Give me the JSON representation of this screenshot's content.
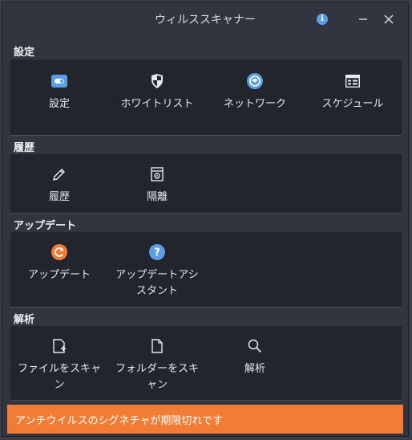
{
  "window": {
    "title": "ウィルススキャナー"
  },
  "sections": {
    "settings": {
      "title": "設定",
      "items": [
        {
          "label": "設定",
          "icon": "toggle-icon"
        },
        {
          "label": "ホワイトリスト",
          "icon": "shield-icon"
        },
        {
          "label": "ネットワーク",
          "icon": "globe-icon"
        },
        {
          "label": "スケジュール",
          "icon": "calendar-icon"
        }
      ]
    },
    "history": {
      "title": "履歴",
      "items": [
        {
          "label": "履歴",
          "icon": "pencil-icon"
        },
        {
          "label": "隔離",
          "icon": "quarantine-icon"
        }
      ]
    },
    "update": {
      "title": "アップデート",
      "items": [
        {
          "label": "アップデート",
          "icon": "refresh-icon"
        },
        {
          "label": "アップデートアシスタント",
          "icon": "help-icon"
        }
      ]
    },
    "analysis": {
      "title": "解析",
      "items": [
        {
          "label": "ファイルをスキャン",
          "icon": "file-add-icon"
        },
        {
          "label": "フォルダーをスキャン",
          "icon": "document-icon"
        },
        {
          "label": "解析",
          "icon": "magnifier-icon"
        }
      ]
    }
  },
  "status_banner": {
    "text": "アンチウイルスのシグネチャが期限切れです"
  },
  "colors": {
    "banner": "#f07c35",
    "accent_blue": "#5b9ee6",
    "accent_orange": "#f07c35",
    "panel": "#23252d",
    "window": "#32353f"
  }
}
